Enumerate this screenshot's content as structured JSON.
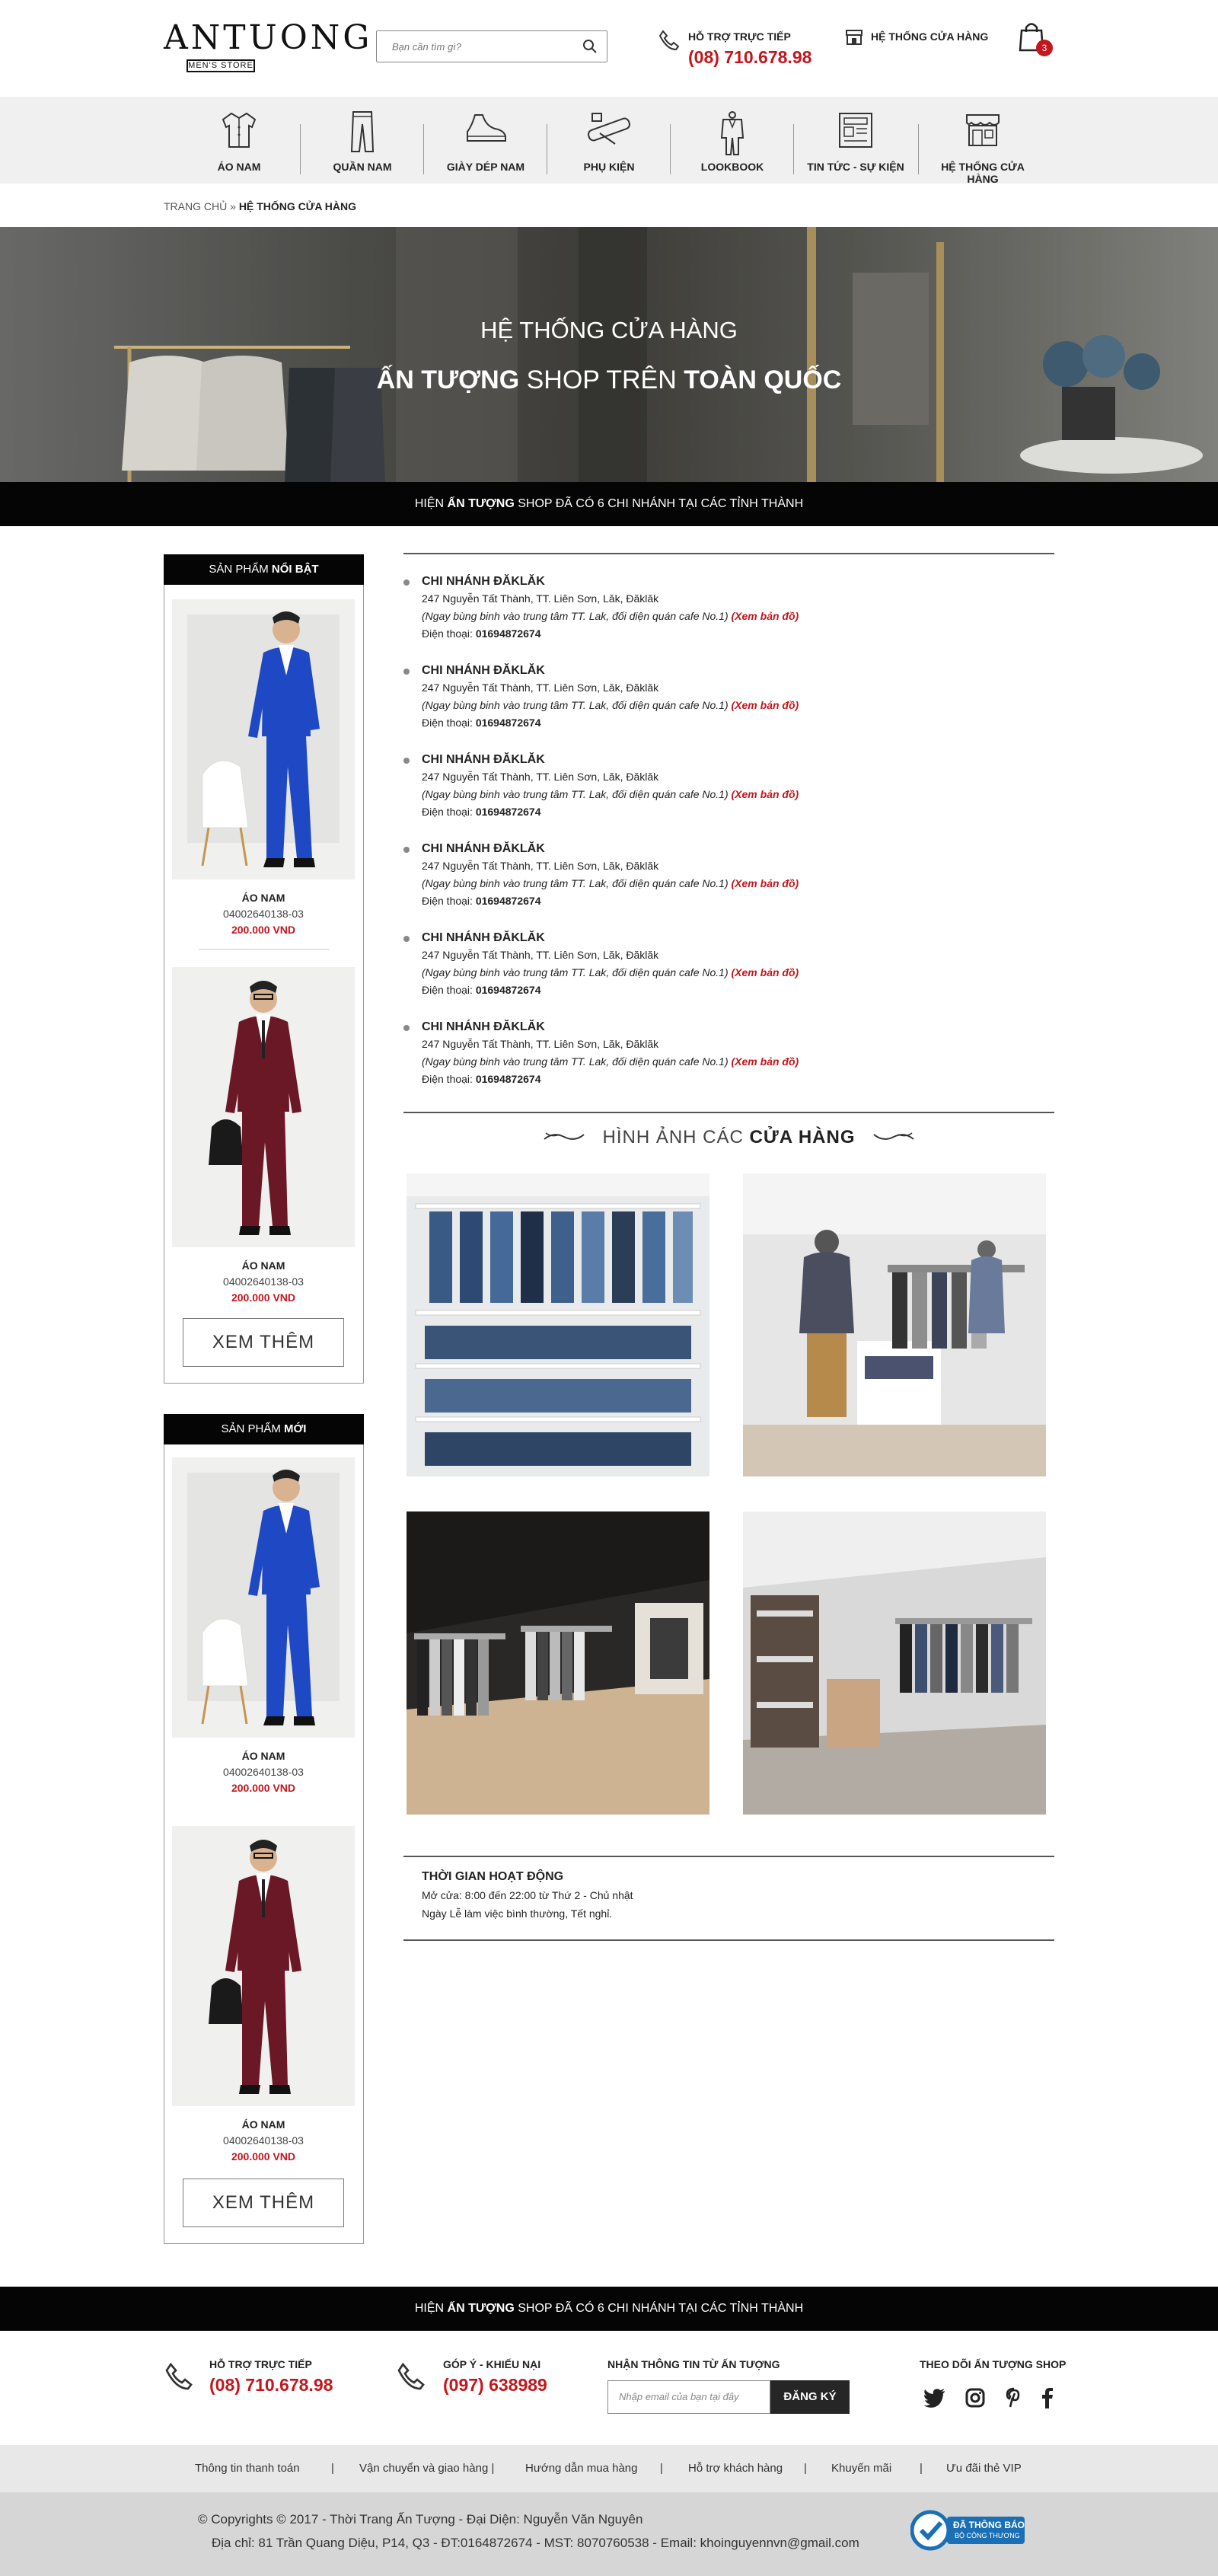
{
  "header": {
    "logo_main": "ANTUONG",
    "logo_sub": "MEN'S STORE",
    "search_placeholder": "Bạn cần tìm gì?",
    "hotline_label": "HỖ TRỢ TRỰC TIẾP",
    "hotline_number": "(08) 710.678.98",
    "stores_label": "HỆ THỐNG CỬA HÀNG",
    "cart_count": "3"
  },
  "nav": {
    "items": [
      {
        "label": "ÁO NAM",
        "icon": "shirt-icon"
      },
      {
        "label": "QUẦN NAM",
        "icon": "pants-icon"
      },
      {
        "label": "GIÀY DÉP NAM",
        "icon": "shoe-icon"
      },
      {
        "label": "PHỤ KIỆN",
        "icon": "tie-accessory-icon"
      },
      {
        "label": "LOOKBOOK",
        "icon": "suit-icon"
      },
      {
        "label": "TIN TỨC - SỰ KIỆN",
        "icon": "newspaper-icon"
      },
      {
        "label": "HỆ THỐNG CỬA HÀNG",
        "icon": "storefront-icon"
      }
    ]
  },
  "breadcrumb": {
    "home": "TRANG CHỦ",
    "sep": "»",
    "current": "HỆ THỐNG CỬA HÀNG"
  },
  "hero": {
    "title": "HỆ THỐNG CỬA HÀNG",
    "sub_bold1": "ẤN TƯỢNG",
    "sub_mid": " SHOP TRÊN ",
    "sub_bold2": "TOÀN QUỐC"
  },
  "branch_bar": {
    "pre": "HIỆN ",
    "bold": "ẤN TƯỢNG",
    "post": " SHOP ĐÃ CÓ 6 CHI NHÁNH TẠI CÁC TỈNH THÀNH"
  },
  "sidebar": {
    "featured": {
      "title_pre": "SẢN PHẨM ",
      "title_bold": "NỔI BẬT",
      "products": [
        {
          "name": "ÁO NAM",
          "code": "04002640138-03",
          "price": "200.000 VND",
          "suit_color": "#1f49c4"
        },
        {
          "name": "ÁO NAM",
          "code": "04002640138-03",
          "price": "200.000 VND",
          "suit_color": "#6b1826"
        }
      ],
      "more": "XEM THÊM"
    },
    "new": {
      "title_pre": "SẢN PHẨM ",
      "title_bold": "MỚI",
      "products": [
        {
          "name": "ÁO NAM",
          "code": "04002640138-03",
          "price": "200.000 VND",
          "suit_color": "#1f49c4"
        },
        {
          "name": "ÁO NAM",
          "code": "04002640138-03",
          "price": "200.000 VND",
          "suit_color": "#6b1826"
        }
      ],
      "more": "XEM THÊM"
    }
  },
  "branches": [
    {
      "name": "CHI NHÁNH ĐĂKLĂK",
      "address": "247 Nguyễn Tất Thành, TT. Liên Sơn, Lăk, Đăklăk",
      "note": "(Ngay bùng binh vào trung tâm TT. Lak, đối diện quán cafe No.1) ",
      "map": "(Xem bản đồ)",
      "phone_label": "Điện thoại: ",
      "phone": "01694872674"
    },
    {
      "name": "CHI NHÁNH ĐĂKLĂK",
      "address": "247 Nguyễn Tất Thành, TT. Liên Sơn, Lăk, Đăklăk",
      "note": "(Ngay bùng binh vào trung tâm TT. Lak, đối diện quán cafe No.1) ",
      "map": "(Xem bản đồ)",
      "phone_label": "Điện thoại: ",
      "phone": "01694872674"
    },
    {
      "name": "CHI NHÁNH ĐĂKLĂK",
      "address": "247 Nguyễn Tất Thành, TT. Liên Sơn, Lăk, Đăklăk",
      "note": "(Ngay bùng binh vào trung tâm TT. Lak, đối diện quán cafe No.1) ",
      "map": "(Xem bản đồ)",
      "phone_label": "Điện thoại: ",
      "phone": "01694872674"
    },
    {
      "name": "CHI NHÁNH ĐĂKLĂK",
      "address": "247 Nguyễn Tất Thành, TT. Liên Sơn, Lăk, Đăklăk",
      "note": "(Ngay bùng binh vào trung tâm TT. Lak, đối diện quán cafe No.1) ",
      "map": "(Xem bản đồ)",
      "phone_label": "Điện thoại: ",
      "phone": "01694872674"
    },
    {
      "name": "CHI NHÁNH ĐĂKLĂK",
      "address": "247 Nguyễn Tất Thành, TT. Liên Sơn, Lăk, Đăklăk",
      "note": "(Ngay bùng binh vào trung tâm TT. Lak, đối diện quán cafe No.1) ",
      "map": "(Xem bản đồ)",
      "phone_label": "Điện thoại: ",
      "phone": "01694872674"
    },
    {
      "name": "CHI NHÁNH ĐĂKLĂK",
      "address": "247 Nguyễn Tất Thành, TT. Liên Sơn, Lăk, Đăklăk",
      "note": "(Ngay bùng binh vào trung tâm TT. Lak, đối diện quán cafe No.1) ",
      "map": "(Xem bản đồ)",
      "phone_label": "Điện thoại: ",
      "phone": "01694872674"
    }
  ],
  "gallery": {
    "title_pre": "HÌNH ẢNH CÁC ",
    "title_bold": "CỬA HÀNG"
  },
  "hours": {
    "title": "THỜI GIAN HOẠT ĐỘNG",
    "line1": "Mở cửa: 8:00 đến 22:00 từ Thứ 2 - Chủ nhật",
    "line2": "Ngày Lễ làm việc bình thường, Tết nghỉ."
  },
  "footer": {
    "support_label": "HỖ TRỢ TRỰC TIẾP",
    "support_number": "(08) 710.678.98",
    "feedback_label": "GÓP Ý - KHIẾU NẠI",
    "feedback_number": "(097) 638989",
    "newsletter_label": "NHẬN THÔNG TIN TỪ ẤN TƯỢNG",
    "newsletter_placeholder": "Nhập email của bạn tại đây",
    "newsletter_button": "ĐĂNG KÝ",
    "follow_label": "THEO DÕI ẤN TƯỢNG SHOP",
    "links": [
      "Thông tin thanh toán",
      "|",
      "Vận chuyển và giao hàng |",
      "Hướng dẫn mua hàng",
      "|",
      "Hỗ trợ khách hàng",
      "|",
      "Khuyến mãi",
      "|",
      "Ưu đãi thẻ VIP"
    ],
    "copyright": "© Copyrights © 2017 - Thời Trang Ấn Tượng - Đại Diện: Nguyễn Văn Nguyên",
    "address": "Địa chỉ: 81 Trần Quang Diệu, P14, Q3 - ĐT:0164872674 - MST: 8070760538 - Email: khoinguyennvn@gmail.com",
    "bct_line1": "ĐÃ THÔNG BÁO",
    "bct_line2": "BỘ CÔNG THƯƠNG"
  },
  "colors": {
    "accent": "#c4161c",
    "dark": "#050505",
    "nav_bg": "#f0f0f0"
  }
}
